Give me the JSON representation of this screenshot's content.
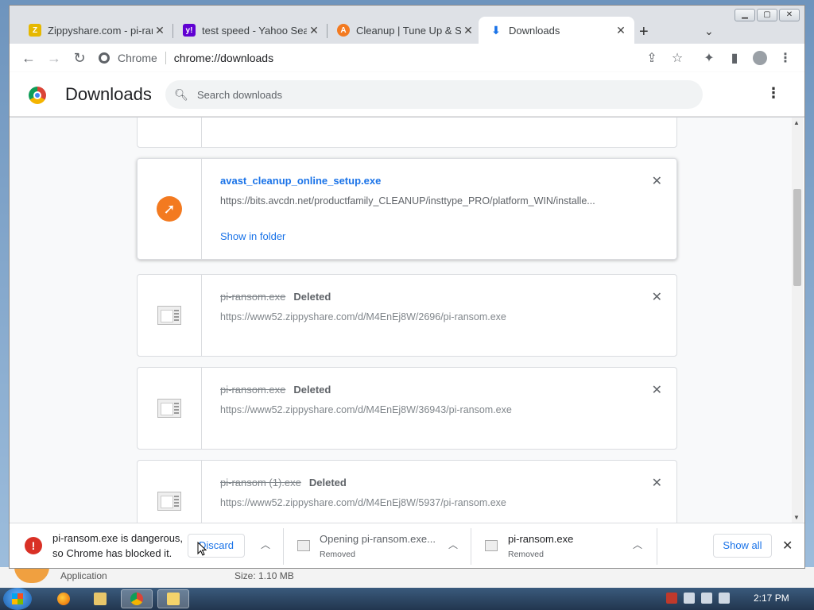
{
  "tabs": [
    {
      "title": "Zippyshare.com - pi-ransom.exe",
      "icon": "zippyshare-icon",
      "color": "#e6b800"
    },
    {
      "title": "test speed - Yahoo Search Results",
      "icon": "yahoo-icon",
      "color": "#6001d2"
    },
    {
      "title": "Cleanup | Tune Up & Speed Up",
      "icon": "avast-icon",
      "color": "#f37a20"
    },
    {
      "title": "Downloads",
      "icon": "download-icon",
      "color": "#1a73e8"
    }
  ],
  "toolbar": {
    "site_chip": "Chrome",
    "url": "chrome://downloads"
  },
  "page": {
    "title": "Downloads",
    "search_placeholder": "Search downloads"
  },
  "downloads": [
    {
      "name": "avast_cleanup_online_setup.exe",
      "url": "https://bits.avcdn.net/productfamily_CLEANUP/insttype_PRO/platform_WIN/installe...",
      "action": "Show in folder",
      "state": "complete"
    },
    {
      "name": "pi-ransom.exe",
      "status": "Deleted",
      "url": "https://www52.zippyshare.com/d/M4EnEj8W/2696/pi-ransom.exe",
      "state": "deleted"
    },
    {
      "name": "pi-ransom.exe",
      "status": "Deleted",
      "url": "https://www52.zippyshare.com/d/M4EnEj8W/36943/pi-ransom.exe",
      "state": "deleted"
    },
    {
      "name": "pi-ransom (1).exe",
      "status": "Deleted",
      "url": "https://www52.zippyshare.com/d/M4EnEj8W/5937/pi-ransom.exe",
      "state": "deleted"
    }
  ],
  "shelf": {
    "warning_line1": "pi-ransom.exe is dangerous,",
    "warning_line2": "so Chrome has blocked it.",
    "discard_label": "Discard",
    "item1_name": "Opening pi-ransom.exe...",
    "item1_sub": "Removed",
    "item2_name": "pi-ransom.exe",
    "item2_sub": "Removed",
    "show_all_label": "Show all"
  },
  "desktop": {
    "behind_app": "Application",
    "behind_size": "Size: 1.10 MB"
  },
  "taskbar": {
    "clock": "2:17 PM"
  }
}
